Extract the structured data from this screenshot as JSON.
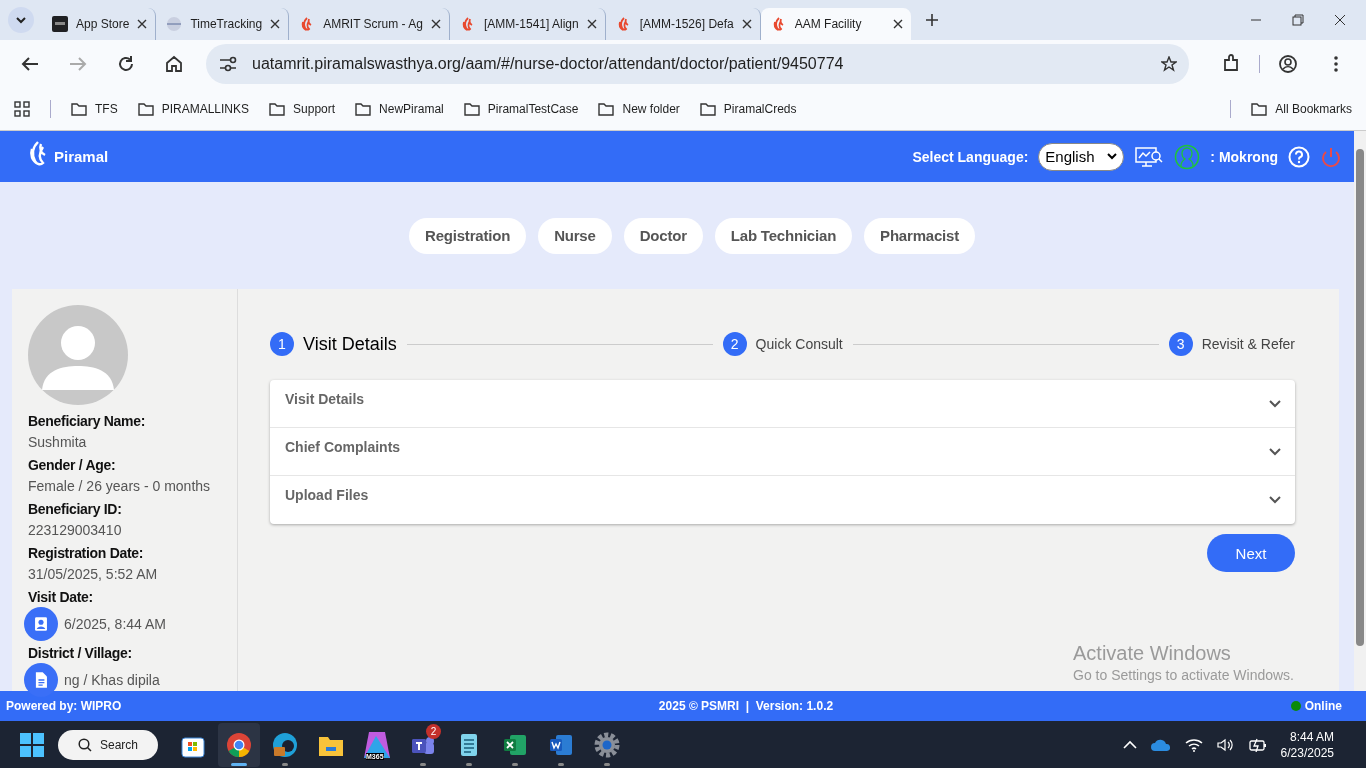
{
  "browser": {
    "tabs": [
      {
        "title": "App Store",
        "kind": "store",
        "selected": false
      },
      {
        "title": "TimeTracking",
        "kind": "globe",
        "selected": false
      },
      {
        "title": "AMRIT Scrum - Ag",
        "kind": "piramal",
        "selected": false
      },
      {
        "title": "[AMM-1541] Align",
        "kind": "piramal",
        "selected": false
      },
      {
        "title": "[AMM-1526] Defa",
        "kind": "piramal",
        "selected": false
      },
      {
        "title": "AAM Facility",
        "kind": "piramal",
        "selected": true
      }
    ],
    "url": "uatamrit.piramalswasthya.org/aam/#/nurse-doctor/attendant/doctor/patient/9450774",
    "bookmarks": [
      "TFS",
      "PIRAMALLINKS",
      "Support",
      "NewPiramal",
      "PiramalTestCase",
      "New folder",
      "PiramalCreds"
    ],
    "all_bookmarks": "All Bookmarks"
  },
  "app": {
    "logo": "Piramal",
    "language_label": "Select Language:",
    "language": "English",
    "user": ": Mokrong",
    "roles": [
      "Registration",
      "Nurse",
      "Doctor",
      "Lab Technician",
      "Pharmacist"
    ],
    "patient": [
      {
        "label": "Beneficiary Name:",
        "value": "Sushmita",
        "kind": "text"
      },
      {
        "label": "Gender / Age:",
        "value": "Female / 26 years - 0 months",
        "kind": "text"
      },
      {
        "label": "Beneficiary ID:",
        "value": "223129003410",
        "kind": "text"
      },
      {
        "label": "Registration Date:",
        "value": "31/05/2025, 5:52 AM",
        "kind": "text"
      },
      {
        "label": "Visit Date:",
        "value": "6/2025, 8:44 AM",
        "kind": "person"
      },
      {
        "label": "District / Village:",
        "value": "ng / Khas dipila",
        "kind": "document"
      }
    ],
    "steps": [
      {
        "number": "1",
        "title": "Visit Details",
        "selected": true
      },
      {
        "number": "2",
        "title": "Quick Consult",
        "selected": false
      },
      {
        "number": "3",
        "title": "Revisit & Refer",
        "selected": false
      }
    ],
    "sections": [
      {
        "title": "Visit Details",
        "expanded": false
      },
      {
        "title": "Chief Complaints",
        "expanded": false
      },
      {
        "title": "Upload Files",
        "expanded": false
      }
    ],
    "next_button": "Next",
    "footer": {
      "powered_by": "Powered by: WIPRO",
      "copyright": "2025 © PSMRI  |  Version: 1.0.2",
      "status": "Online"
    }
  },
  "os_notice": {
    "title": "Activate Windows",
    "text": "Go to Settings to activate Windows."
  },
  "taskbar": {
    "search": "Search",
    "apps": [
      {
        "kind": "store",
        "selected": false,
        "running": false
      },
      {
        "kind": "chrome",
        "selected": true,
        "running": true
      },
      {
        "kind": "edge",
        "selected": false,
        "running": true
      },
      {
        "kind": "folder",
        "selected": false,
        "running": false
      },
      {
        "kind": "m365",
        "label": "M365",
        "selected": false,
        "running": false
      },
      {
        "kind": "teams",
        "badge": "2",
        "selected": false,
        "running": true
      },
      {
        "kind": "notepad",
        "selected": false,
        "running": true
      },
      {
        "kind": "excel",
        "selected": false,
        "running": true
      },
      {
        "kind": "word",
        "selected": false,
        "running": true
      },
      {
        "kind": "settings",
        "selected": false,
        "running": true
      }
    ],
    "time": "8:44 AM",
    "date": "6/23/2025"
  }
}
